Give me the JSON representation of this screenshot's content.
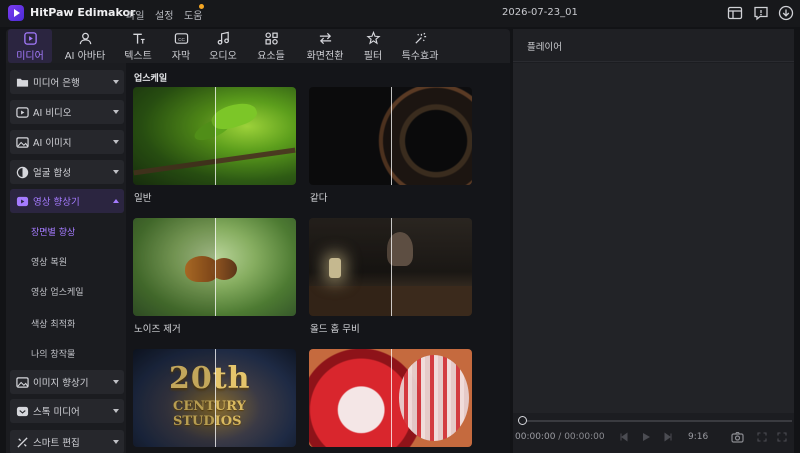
{
  "app": {
    "name": "HitPaw Edimakor",
    "project_name": "2026-07-23_01",
    "accent": "#a57bff"
  },
  "menu": [
    {
      "label": "파일"
    },
    {
      "label": "설정"
    },
    {
      "label": "도움"
    }
  ],
  "tabs": [
    {
      "label": "미디어",
      "icon": "media-icon"
    },
    {
      "label": "AI 아바타",
      "icon": "avatar-icon"
    },
    {
      "label": "텍스트",
      "icon": "text-icon"
    },
    {
      "label": "자막",
      "icon": "subtitle-icon"
    },
    {
      "label": "오디오",
      "icon": "audio-icon"
    },
    {
      "label": "요소들",
      "icon": "elements-icon"
    },
    {
      "label": "화면전환",
      "icon": "transition-icon"
    },
    {
      "label": "필터",
      "icon": "filter-icon"
    },
    {
      "label": "특수효과",
      "icon": "effects-icon"
    }
  ],
  "sidebar": {
    "items": [
      {
        "label": "미디어 은행"
      },
      {
        "label": "AI 비디오"
      },
      {
        "label": "AI  이미지"
      },
      {
        "label": "얼굴 합성"
      },
      {
        "label": "영상 향상기"
      }
    ],
    "sub_items": [
      {
        "label": "장면별 향상"
      },
      {
        "label": "영상 복원"
      },
      {
        "label": "영상 업스케일"
      },
      {
        "label": "색상 최적화"
      },
      {
        "label": "나의 창작물"
      }
    ],
    "items_after": [
      {
        "label": "이미지 향상기"
      },
      {
        "label": "스톡 미디어"
      },
      {
        "label": "스마트 편집"
      }
    ]
  },
  "content": {
    "section_title": "업스케일",
    "cards": [
      {
        "label": "일반"
      },
      {
        "label": "같다"
      },
      {
        "label": "노이즈 제거"
      },
      {
        "label": "올드 홈 무비"
      },
      {
        "label": "",
        "thumb_text": "20th",
        "thumb_text2": "CENTURY STUDIOS"
      },
      {
        "label": ""
      }
    ]
  },
  "player": {
    "title": "플레이어",
    "current_time": "00:00:00",
    "total_time": "00:00:00",
    "duration": "9:16"
  }
}
